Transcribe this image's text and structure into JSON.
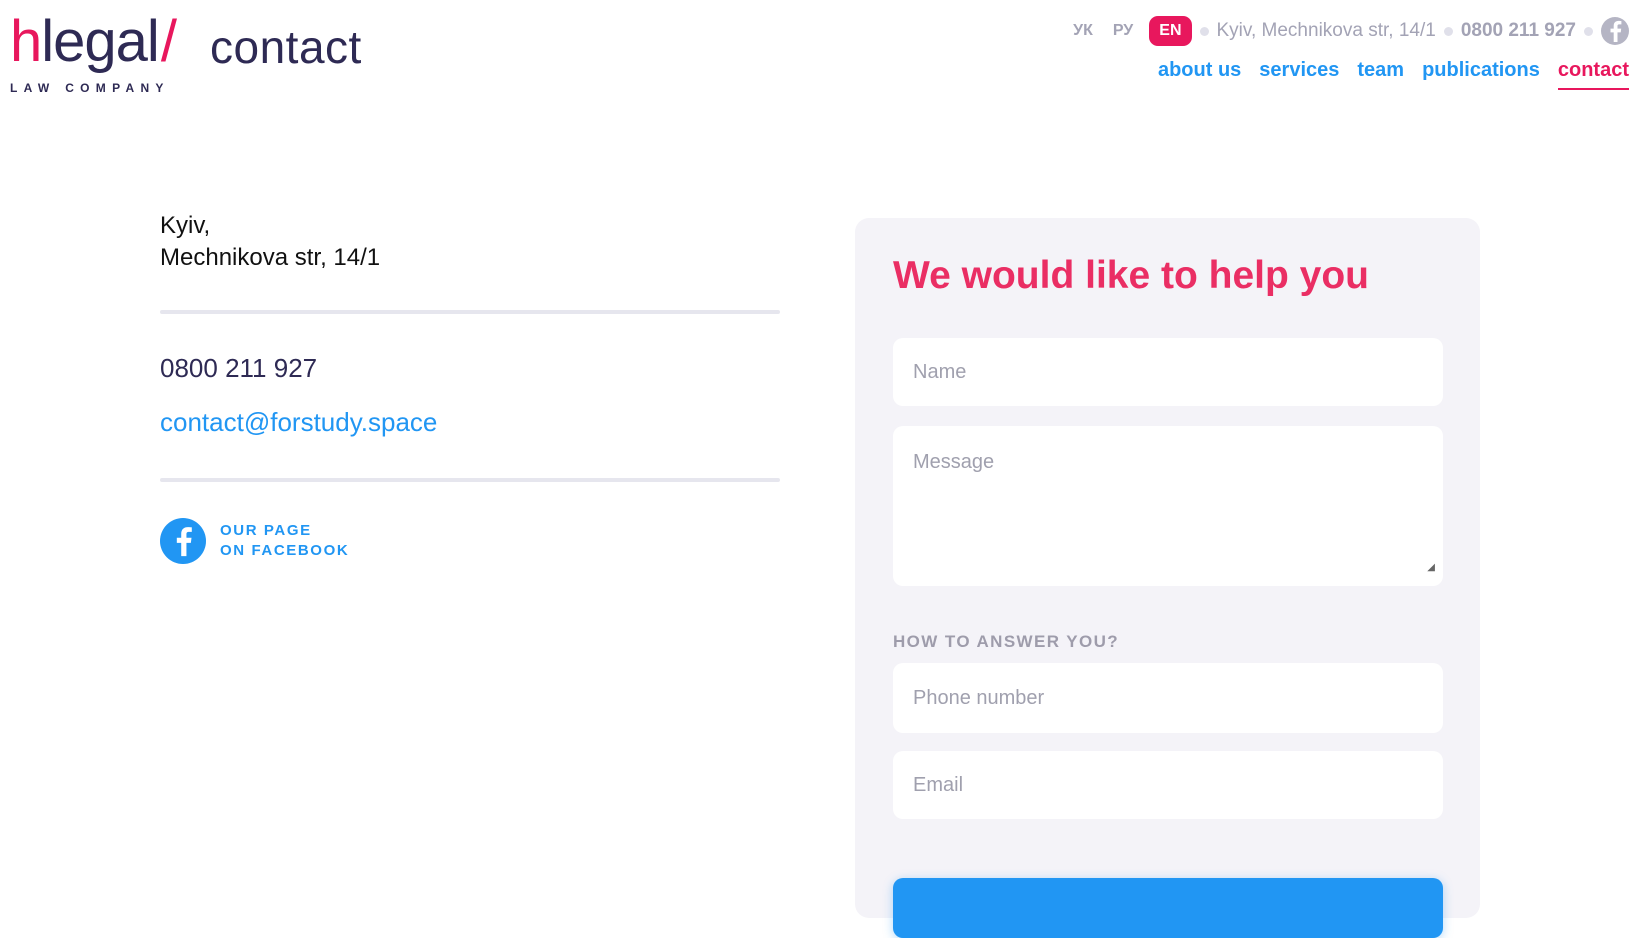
{
  "logo": {
    "h": "h",
    "rest": "legal",
    "slash": "/",
    "section": "contact",
    "subtitle": "LAW COMPANY"
  },
  "topbar": {
    "languages": [
      "УК",
      "РУ",
      "EN"
    ],
    "active_language": "EN",
    "address": "Kyiv, Mechnikova str, 14/1",
    "phone": "0800 211 927"
  },
  "nav": {
    "items": [
      "about us",
      "services",
      "team",
      "publications",
      "contact"
    ],
    "active": "contact"
  },
  "contacts": {
    "city": "Kyiv,",
    "street": "Mechnikova str, 14/1",
    "phone": "0800 211 927",
    "email": "contact@forstudy.space",
    "facebook_line1": "OUR PAGE",
    "facebook_line2": "ON FACEBOOK"
  },
  "form": {
    "title": "We would like to help you",
    "name_placeholder": "Name",
    "message_placeholder": "Message",
    "answer_label": "HOW TO ANSWER YOU?",
    "phone_placeholder": "Phone number",
    "email_placeholder": "Email"
  },
  "colors": {
    "brand_pink": "#e8175d",
    "brand_blue": "#2196f3",
    "brand_navy": "#2e2a54"
  },
  "icons": [
    "facebook-icon",
    "resize-handle-icon"
  ]
}
